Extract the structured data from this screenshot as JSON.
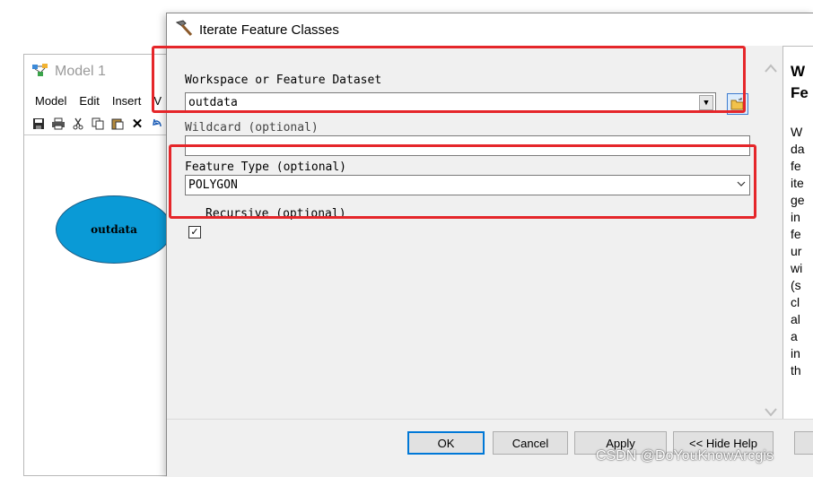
{
  "model_window": {
    "title": "Model 1",
    "menu": [
      "Model",
      "Edit",
      "Insert",
      "V"
    ],
    "toolbar_icons": [
      "save-icon",
      "print-icon",
      "cut-icon",
      "copy-icon",
      "paste-icon",
      "delete-icon",
      "undo-icon"
    ],
    "node_label": "outdata",
    "node_color": "#0a9ad6"
  },
  "dialog": {
    "title": "Iterate Feature Classes",
    "workspace_label": "Workspace or Feature Dataset",
    "workspace_value": "outdata",
    "wildcard_label": "Wildcard (optional)",
    "wildcard_value": "",
    "feature_type_label": "Feature Type (optional)",
    "feature_type_value": "POLYGON",
    "recursive_label": "Recursive (optional)",
    "recursive_checked": true,
    "highlight_color": "#e5262a"
  },
  "help": {
    "title_lines": [
      "W",
      "Fe"
    ],
    "body_lines": [
      "W",
      "da",
      "fe",
      "ite",
      "ge",
      "in",
      "fe",
      "ur",
      "wi",
      "(s",
      "cl",
      "al",
      "a",
      "in",
      "th"
    ]
  },
  "buttons": {
    "ok": "OK",
    "cancel": "Cancel",
    "apply": "Apply",
    "hide_help": "<< Hide Help"
  },
  "watermark": "CSDN @DoYouKnowArcgis"
}
